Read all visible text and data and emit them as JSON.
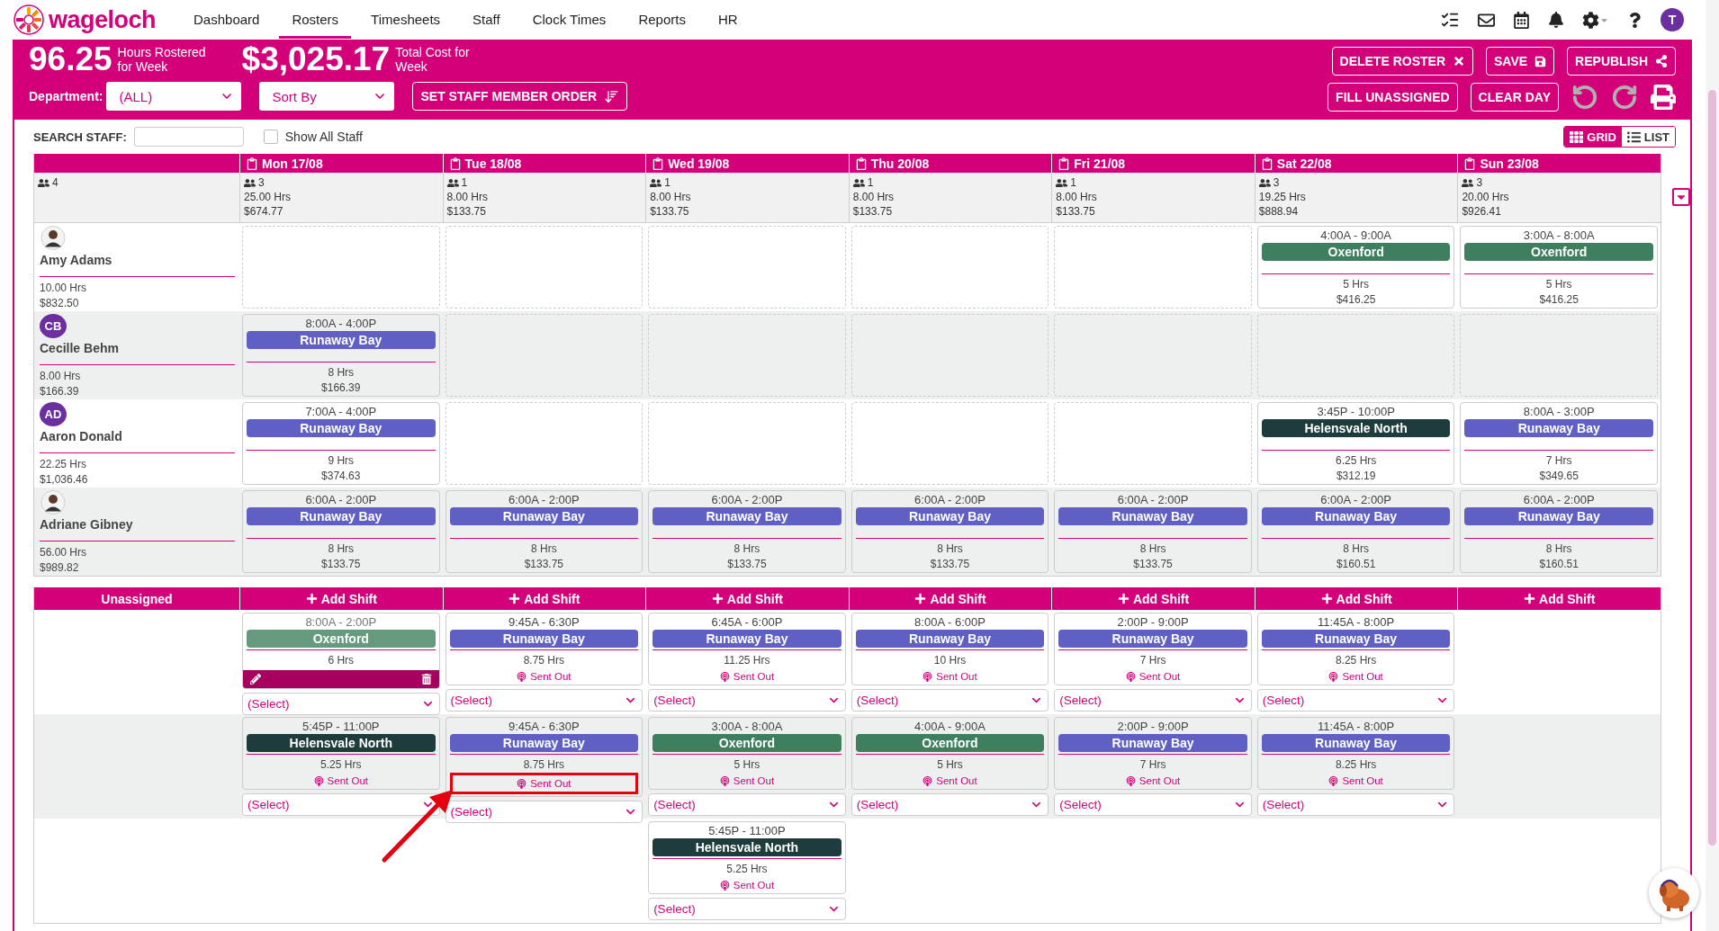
{
  "nav": {
    "logo": "wageloch",
    "items": [
      {
        "label": "Dashboard",
        "selected": false
      },
      {
        "label": "Rosters",
        "selected": true
      },
      {
        "label": "Timesheets",
        "selected": false
      },
      {
        "label": "Staff",
        "selected": false
      },
      {
        "label": "Clock Times",
        "selected": false
      },
      {
        "label": "Reports",
        "selected": false
      },
      {
        "label": "HR",
        "selected": false
      }
    ],
    "user_initial": "T"
  },
  "header": {
    "stats": [
      {
        "value": "96.25",
        "label": "Hours Rostered for Week"
      },
      {
        "value": "$3,025.17",
        "label": "Total Cost for Week"
      }
    ],
    "department": {
      "label": "Department:",
      "value": "(ALL)"
    },
    "sort": {
      "value": "Sort By"
    },
    "order_button": "SET STAFF MEMBER ORDER",
    "actions": [
      {
        "label": "DELETE ROSTER",
        "kind": "delete"
      },
      {
        "label": "SAVE",
        "kind": "save"
      },
      {
        "label": "REPUBLISH",
        "kind": "share"
      }
    ],
    "tools": [
      {
        "label": "FILL UNASSIGNED"
      },
      {
        "label": "CLEAR DAY"
      }
    ],
    "undo": {
      "disabled": true
    },
    "redo": {
      "disabled": true
    }
  },
  "search": {
    "label": "SEARCH STAFF:",
    "show_all": {
      "label": "Show All Staff",
      "checked": false
    },
    "view_toggle": [
      {
        "label": "GRID",
        "kind": "grid",
        "selected": true
      },
      {
        "label": "LIST",
        "kind": "list",
        "selected": false
      }
    ]
  },
  "roster": {
    "staff_count": "4",
    "days": [
      {
        "label": "Mon 17/08",
        "staff_count": "3",
        "hours": "25.00 Hrs",
        "cost": "$674.77"
      },
      {
        "label": "Tue 18/08",
        "staff_count": "1",
        "hours": "8.00 Hrs",
        "cost": "$133.75"
      },
      {
        "label": "Wed 19/08",
        "staff_count": "1",
        "hours": "8.00 Hrs",
        "cost": "$133.75"
      },
      {
        "label": "Thu 20/08",
        "staff_count": "1",
        "hours": "8.00 Hrs",
        "cost": "$133.75"
      },
      {
        "label": "Fri 21/08",
        "staff_count": "1",
        "hours": "8.00 Hrs",
        "cost": "$133.75"
      },
      {
        "label": "Sat 22/08",
        "staff_count": "3",
        "hours": "19.25 Hrs",
        "cost": "$888.94"
      },
      {
        "label": "Sun 23/08",
        "staff_count": "3",
        "hours": "20.00 Hrs",
        "cost": "$926.41"
      }
    ],
    "staff": [
      {
        "name": "Amy Adams",
        "avatar": {
          "kind": "photo"
        },
        "hours": "10.00 Hrs",
        "cost": "$832.50",
        "shifts": [
          {
            "kind": "empty"
          },
          {
            "kind": "empty"
          },
          {
            "kind": "empty"
          },
          {
            "kind": "empty"
          },
          {
            "kind": "empty"
          },
          {
            "kind": "shift",
            "time": "4:00A - 9:00A",
            "location": "Oxenford",
            "color": "#3d7f5f",
            "hours": "5 Hrs",
            "cost": "$416.25"
          },
          {
            "kind": "shift",
            "time": "3:00A - 8:00A",
            "location": "Oxenford",
            "color": "#3d7f5f",
            "hours": "5 Hrs",
            "cost": "$416.25"
          }
        ]
      },
      {
        "name": "Cecille Behm",
        "avatar": {
          "kind": "initials",
          "initials": "CB"
        },
        "hours": "8.00 Hrs",
        "cost": "$166.39",
        "shifts": [
          {
            "kind": "shift",
            "time": "8:00A - 4:00P",
            "location": "Runaway Bay",
            "color": "#5f5fc4",
            "hours": "8 Hrs",
            "cost": "$166.39"
          },
          {
            "kind": "empty"
          },
          {
            "kind": "empty"
          },
          {
            "kind": "empty"
          },
          {
            "kind": "empty"
          },
          {
            "kind": "empty"
          },
          {
            "kind": "empty"
          }
        ]
      },
      {
        "name": "Aaron Donald",
        "avatar": {
          "kind": "initials",
          "initials": "AD"
        },
        "hours": "22.25 Hrs",
        "cost": "$1,036.46",
        "shifts": [
          {
            "kind": "shift",
            "time": "7:00A - 4:00P",
            "location": "Runaway Bay",
            "color": "#5f5fc4",
            "hours": "9 Hrs",
            "cost": "$374.63"
          },
          {
            "kind": "empty"
          },
          {
            "kind": "empty"
          },
          {
            "kind": "empty"
          },
          {
            "kind": "empty"
          },
          {
            "kind": "shift",
            "time": "3:45P - 10:00P",
            "location": "Helensvale North",
            "color": "#1e3c3c",
            "hours": "6.25 Hrs",
            "cost": "$312.19"
          },
          {
            "kind": "shift",
            "time": "8:00A - 3:00P",
            "location": "Runaway Bay",
            "color": "#5f5fc4",
            "hours": "7 Hrs",
            "cost": "$349.65"
          }
        ]
      },
      {
        "name": "Adriane Gibney",
        "avatar": {
          "kind": "photo"
        },
        "hours": "56.00 Hrs",
        "cost": "$989.82",
        "shifts": [
          {
            "kind": "shift",
            "time": "6:00A - 2:00P",
            "location": "Runaway Bay",
            "color": "#5f5fc4",
            "hours": "8 Hrs",
            "cost": "$133.75"
          },
          {
            "kind": "shift",
            "time": "6:00A - 2:00P",
            "location": "Runaway Bay",
            "color": "#5f5fc4",
            "hours": "8 Hrs",
            "cost": "$133.75"
          },
          {
            "kind": "shift",
            "time": "6:00A - 2:00P",
            "location": "Runaway Bay",
            "color": "#5f5fc4",
            "hours": "8 Hrs",
            "cost": "$133.75"
          },
          {
            "kind": "shift",
            "time": "6:00A - 2:00P",
            "location": "Runaway Bay",
            "color": "#5f5fc4",
            "hours": "8 Hrs",
            "cost": "$133.75"
          },
          {
            "kind": "shift",
            "time": "6:00A - 2:00P",
            "location": "Runaway Bay",
            "color": "#5f5fc4",
            "hours": "8 Hrs",
            "cost": "$133.75"
          },
          {
            "kind": "shift",
            "time": "6:00A - 2:00P",
            "location": "Runaway Bay",
            "color": "#5f5fc4",
            "hours": "8 Hrs",
            "cost": "$160.51"
          },
          {
            "kind": "shift",
            "time": "6:00A - 2:00P",
            "location": "Runaway Bay",
            "color": "#5f5fc4",
            "hours": "8 Hrs",
            "cost": "$160.51"
          }
        ]
      }
    ]
  },
  "unassigned": {
    "title": "Unassigned",
    "add_buttons": [
      "Add Shift",
      "Add Shift",
      "Add Shift",
      "Add Shift",
      "Add Shift",
      "Add Shift",
      "Add Shift"
    ],
    "rows": [
      {
        "cells": [
          {
            "kind": "shift",
            "time": "8:00A - 2:00P",
            "location": "Oxenford",
            "color": "#659a7e",
            "hours": "6 Hrs",
            "editing": true,
            "highlighted": false,
            "assignee": "(Select)"
          },
          {
            "kind": "shift",
            "time": "9:45A - 6:30P",
            "location": "Runaway Bay",
            "color": "#5f5fc4",
            "hours": "8.75 Hrs",
            "status": "Sent Out",
            "editing": false,
            "highlighted": false,
            "assignee": "(Select)"
          },
          {
            "kind": "shift",
            "time": "6:45A - 6:00P",
            "location": "Runaway Bay",
            "color": "#5f5fc4",
            "hours": "11.25 Hrs",
            "status": "Sent Out",
            "editing": false,
            "highlighted": false,
            "assignee": "(Select)"
          },
          {
            "kind": "shift",
            "time": "8:00A - 6:00P",
            "location": "Runaway Bay",
            "color": "#5f5fc4",
            "hours": "10 Hrs",
            "status": "Sent Out",
            "editing": false,
            "highlighted": false,
            "assignee": "(Select)"
          },
          {
            "kind": "shift",
            "time": "2:00P - 9:00P",
            "location": "Runaway Bay",
            "color": "#5f5fc4",
            "hours": "7 Hrs",
            "status": "Sent Out",
            "editing": false,
            "highlighted": false,
            "assignee": "(Select)"
          },
          {
            "kind": "shift",
            "time": "11:45A - 8:00P",
            "location": "Runaway Bay",
            "color": "#5f5fc4",
            "hours": "8.25 Hrs",
            "status": "Sent Out",
            "editing": false,
            "highlighted": false,
            "assignee": "(Select)"
          },
          {
            "kind": "empty"
          }
        ]
      },
      {
        "cells": [
          {
            "kind": "shift",
            "time": "5:45P - 11:00P",
            "location": "Helensvale North",
            "color": "#1e3c3c",
            "hours": "5.25 Hrs",
            "status": "Sent Out",
            "editing": false,
            "highlighted": false,
            "assignee": "(Select)"
          },
          {
            "kind": "shift",
            "time": "9:45A - 6:30P",
            "location": "Runaway Bay",
            "color": "#5f5fc4",
            "hours": "8.75 Hrs",
            "status": "Sent Out",
            "editing": false,
            "highlighted": true,
            "assignee": "(Select)"
          },
          {
            "kind": "shift",
            "time": "3:00A - 8:00A",
            "location": "Oxenford",
            "color": "#3d7f5f",
            "hours": "5 Hrs",
            "status": "Sent Out",
            "editing": false,
            "highlighted": false,
            "assignee": "(Select)"
          },
          {
            "kind": "shift",
            "time": "4:00A - 9:00A",
            "location": "Oxenford",
            "color": "#3d7f5f",
            "hours": "5 Hrs",
            "status": "Sent Out",
            "editing": false,
            "highlighted": false,
            "assignee": "(Select)"
          },
          {
            "kind": "shift",
            "time": "2:00P - 9:00P",
            "location": "Runaway Bay",
            "color": "#5f5fc4",
            "hours": "7 Hrs",
            "status": "Sent Out",
            "editing": false,
            "highlighted": false,
            "assignee": "(Select)"
          },
          {
            "kind": "shift",
            "time": "11:45A - 8:00P",
            "location": "Runaway Bay",
            "color": "#5f5fc4",
            "hours": "8.25 Hrs",
            "status": "Sent Out",
            "editing": false,
            "highlighted": false,
            "assignee": "(Select)"
          },
          {
            "kind": "empty"
          }
        ]
      },
      {
        "cells": [
          {
            "kind": "empty"
          },
          {
            "kind": "empty"
          },
          {
            "kind": "shift",
            "time": "5:45P - 11:00P",
            "location": "Helensvale North",
            "color": "#1e3c3c",
            "hours": "5.25 Hrs",
            "status": "Sent Out",
            "editing": false,
            "highlighted": false,
            "assignee": "(Select)"
          },
          {
            "kind": "empty"
          },
          {
            "kind": "empty"
          },
          {
            "kind": "empty"
          },
          {
            "kind": "empty"
          }
        ]
      }
    ]
  }
}
